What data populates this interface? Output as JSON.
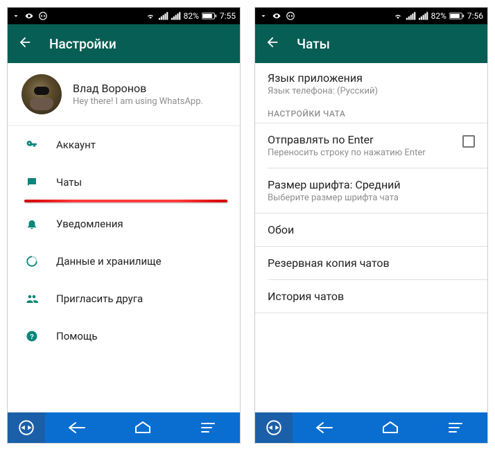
{
  "screen1": {
    "status": {
      "battery": "82%",
      "time": "7:55"
    },
    "appbar": {
      "title": "Настройки"
    },
    "profile": {
      "name": "Влад Воронов",
      "status": "Hey there! I am using WhatsApp."
    },
    "menu": {
      "account": "Аккаунт",
      "chats": "Чаты",
      "notifications": "Уведомления",
      "data": "Данные и хранилище",
      "invite": "Пригласить друга",
      "help": "Помощь"
    }
  },
  "screen2": {
    "status": {
      "battery": "82%",
      "time": "7:56"
    },
    "appbar": {
      "title": "Чаты"
    },
    "language": {
      "title": "Язык приложения",
      "sub": "Язык телефона: (Русский)"
    },
    "section_header": "НАСТРОЙКИ ЧАТА",
    "enter": {
      "title": "Отправлять по Enter",
      "sub": "Переносить строку по нажатию Enter",
      "checked": false
    },
    "font": {
      "title": "Размер шрифта: Средний",
      "sub": "Выберите размер шрифта чата"
    },
    "wallpaper": "Обои",
    "backup": "Резервная копия чатов",
    "history": "История чатов"
  }
}
